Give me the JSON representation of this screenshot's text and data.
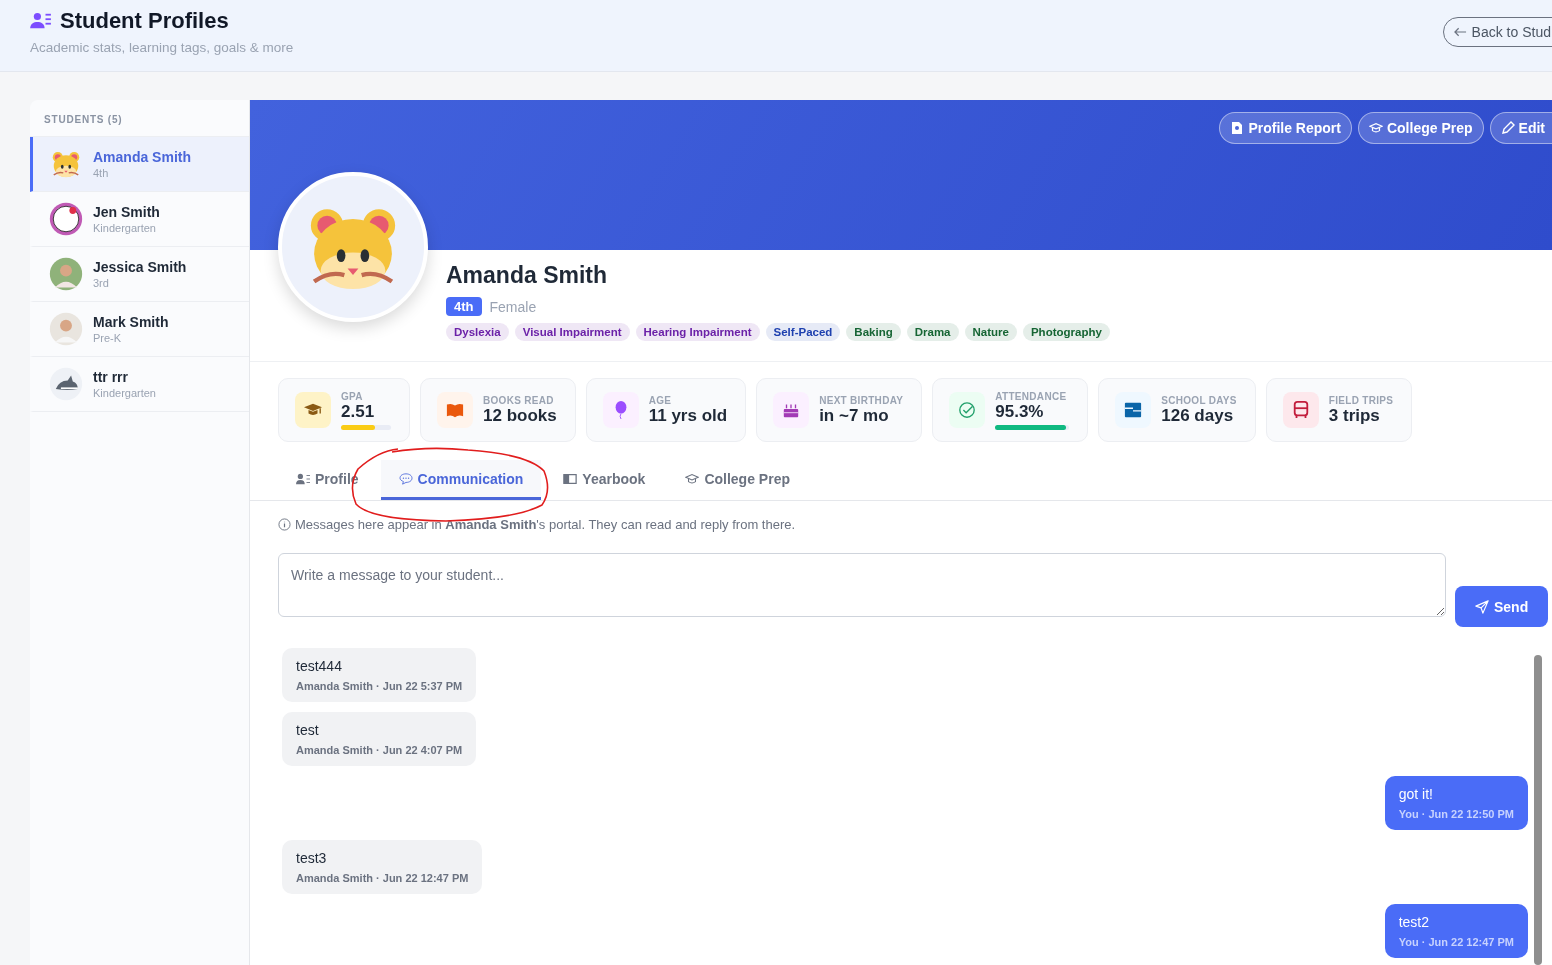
{
  "header": {
    "title": "Student Profiles",
    "subtitle": "Academic stats, learning tags, goals & more",
    "back_button": "Back to Stud"
  },
  "sidebar": {
    "heading": "STUDENTS (5)",
    "students": [
      {
        "name": "Amanda Smith",
        "grade": "4th",
        "selected": true
      },
      {
        "name": "Jen Smith",
        "grade": "Kindergarten",
        "selected": false
      },
      {
        "name": "Jessica Smith",
        "grade": "3rd",
        "selected": false
      },
      {
        "name": "Mark Smith",
        "grade": "Pre-K",
        "selected": false
      },
      {
        "name": "ttr rrr",
        "grade": "Kindergarten",
        "selected": false
      }
    ]
  },
  "banner_actions": [
    "Profile Report",
    "College Prep",
    "Edit"
  ],
  "profile": {
    "name": "Amanda Smith",
    "grade": "4th",
    "gender": "Female",
    "tags": [
      {
        "label": "Dyslexia",
        "color": "#6b21a8"
      },
      {
        "label": "Visual Impairment",
        "color": "#6b21a8"
      },
      {
        "label": "Hearing Impairment",
        "color": "#6b21a8"
      },
      {
        "label": "Self-Paced",
        "color": "#1e40af"
      },
      {
        "label": "Baking",
        "color": "#166534"
      },
      {
        "label": "Drama",
        "color": "#166534"
      },
      {
        "label": "Nature",
        "color": "#166534"
      },
      {
        "label": "Photography",
        "color": "#166534"
      }
    ]
  },
  "stats": [
    {
      "label": "GPA",
      "value": "2.51",
      "level": 0.68
    },
    {
      "label": "BOOKS READ",
      "value": "12 books"
    },
    {
      "label": "AGE",
      "value": "11 yrs old"
    },
    {
      "label": "NEXT BIRTHDAY",
      "value": "in ~7 mo"
    },
    {
      "label": "ATTENDANCE",
      "value": "95.3%",
      "level": 0.953
    },
    {
      "label": "SCHOOL DAYS",
      "value": "126 days"
    },
    {
      "label": "FIELD TRIPS",
      "value": "3 trips"
    }
  ],
  "tabs": [
    {
      "label": "Profile",
      "selected": false
    },
    {
      "label": "Communication",
      "selected": true
    },
    {
      "label": "Yearbook",
      "selected": false
    },
    {
      "label": "College Prep",
      "selected": false
    }
  ],
  "communication": {
    "info": "Messages here appear in **Amanda Smith**'s portal. They can read and reply from there.",
    "compose": {
      "placeholder": "Write a message to your student..."
    },
    "send_button": "Send",
    "messages": [
      {
        "kind": "incoming",
        "text": "test444",
        "meta": "Amanda Smith · Jun 22 5:37 PM"
      },
      {
        "kind": "incoming",
        "text": "test",
        "meta": "Amanda Smith · Jun 22 4:07 PM"
      },
      {
        "kind": "outgoing",
        "text": "got it!",
        "meta": "You · Jun 22 12:50 PM"
      },
      {
        "kind": "incoming",
        "text": "test3",
        "meta": "Amanda Smith · Jun 22 12:47 PM"
      },
      {
        "kind": "outgoing",
        "text": "test2",
        "meta": "You · Jun 22 12:47 PM"
      }
    ]
  }
}
